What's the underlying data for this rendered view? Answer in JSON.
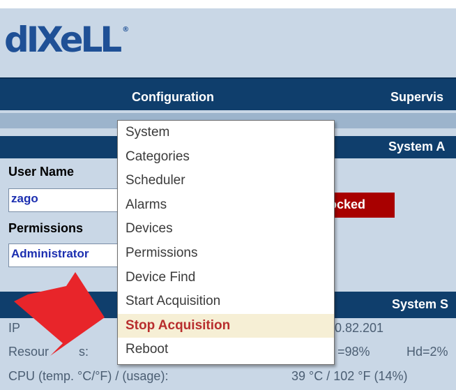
{
  "brand": {
    "logo_text": "dIXeLL",
    "registered": "®"
  },
  "menu": {
    "configuration": "Configuration",
    "supervision": "Supervis"
  },
  "dropdown": {
    "items": [
      "System",
      "Categories",
      "Scheduler",
      "Alarms",
      "Devices",
      "Permissions",
      "Device Find",
      "Start Acquisition",
      "Stop Acquisition",
      "Reboot"
    ],
    "highlighted_index": 8
  },
  "system_access": {
    "header": "System A",
    "user_name_label": "User Name",
    "user_name_value": "zago",
    "permissions_label": "Permissions",
    "permissions_value": "Administrator",
    "status": "ocked"
  },
  "system_status": {
    "header": "System S",
    "ip_label": "IP",
    "ip_value": "0.82.201",
    "resources_label": "Resour",
    "resources_label_tail": "s:",
    "ram_value": "=98%",
    "hd_value": "Hd=2%",
    "cpu_label": "CPU (temp. °C/°F) / (usage):",
    "cpu_value": "39 °C / 102 °F (14%)"
  },
  "colors": {
    "header_bar": "#0f3e6c",
    "background": "#c9d7e6",
    "highlight_bg": "#f6efd5",
    "highlight_text": "#b82e2e",
    "locked_bg": "#a80000",
    "arrow": "#e8252a"
  }
}
